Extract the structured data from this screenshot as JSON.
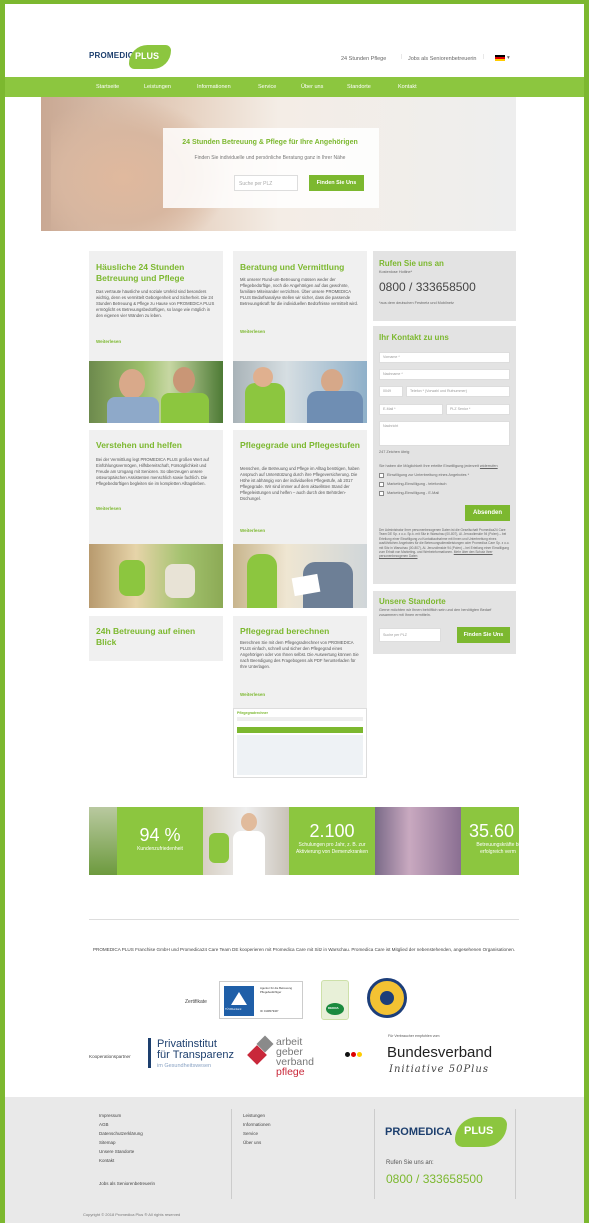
{
  "header": {
    "logo_text": "PROMEDICA",
    "logo_plus": "PLUS",
    "link1": "24 Stunden Pflege",
    "link2": "Jobs als Seniorenbetreuerin",
    "lang_arrow": "▾"
  },
  "nav": [
    "Startseite",
    "Leistungen",
    "Informationen",
    "Service",
    "Über uns",
    "Standorte",
    "Kontakt"
  ],
  "hero": {
    "title": "24 Stunden Betreuung & Pflege für Ihre Angehörigen",
    "subtitle": "Finden Sie individuelle und persönliche Beratung ganz in Ihrer Nähe",
    "placeholder": "Suche per PLZ",
    "button": "Finden Sie Uns"
  },
  "cards": [
    {
      "title": "Häusliche 24 Stunden Betreuung und Pflege",
      "text": "Das vertraute häusliche und soziale Umfeld sind besonders wichtig, denn es vermittelt Geborgenheit und Sicherheit. Die 24 Stunden Betreuung & Pflege zu Hause von PROMEDICA PLUS ermöglicht es Betreuungsbedürftigen, so lange wie möglich in den eigenen vier Wänden zu leben.",
      "more": "Weiterlesen"
    },
    {
      "title": "Beratung und Vermittlung",
      "text": "Mit unserer Rund-um-Betreuung müssen weder der Pflegebedürftige, noch die Angehörigen auf das gewohnte, familiäre Miteinander verzichten. Über unsere PROMEDICA PLUS Bedarfsanalyse stellen wir sicher, dass die passende Betreuungskraft für die individuellen Bedürfnisse vermittelt wird.",
      "more": "Weiterlesen"
    },
    {
      "title": "Verstehen und helfen",
      "text": "Bei der Vermittlung legt PROMEDICA PLUS großen Wert auf Einfühlungsvermögen, Hilfsbereitschaft, Fürsorglichkeit und Freude am Umgang mit Senioren. So überzeugen unsere osteuropäischen Assistenten menschlich sowie fachlich. Die Pflegebedürftigen begleiten sie im kompletten Alltagsleben.",
      "more": "Weiterlesen"
    },
    {
      "title": "Pflegegrade und Pflegestufen",
      "text": "Menschen, die Betreuung und Pflege im Alltag benötigen, haben Anspruch auf Unterstützung durch ihre Pflegeversicherung. Die Höhe ist abhängig von der individuellen Pflegestufe, ab 2017 Pflegegrade. Wir sind immer auf dem aktuellsten Stand der Pflegeleistungen und helfen – auch durch den Behörden-Dschungel.",
      "more": "Weiterlesen"
    },
    {
      "title": "24h Betreuung auf einen Blick",
      "text": "",
      "more": ""
    },
    {
      "title": "Pflegegrad berechnen",
      "text": "Berechnen Sie mit dem Pflegegradrechner von PROMEDICA PLUS einfach, schnell und sicher den Pflegegrad eines Angehörigen oder von Ihnen selbst. Die Auswertung können Sie nach Beendigung des Fragebogens als PDF herunterladen für Ihre Unterlagen.",
      "more": "Weiterlesen",
      "shot_caption": "Pflegegradrechner"
    }
  ],
  "callbox": {
    "title": "Rufen Sie uns an",
    "sub": "Kostenlose Hotline*",
    "phone": "0800 / 333658500",
    "note": "*aus dem deutschen Festnetz und Mobilnetz"
  },
  "contact": {
    "title": "Ihr Kontakt zu uns",
    "firstname": "Vorname *",
    "lastname": "Nachname *",
    "prefix": "0049",
    "phone": "Telefon * (Vorwahl und Rufnummer)",
    "email": "E-Mail *",
    "plz": "PLZ Senior *",
    "message": "Nachricht",
    "counter": "247 Zeichen übrig",
    "consent_intro": "Sie haben die Möglichkeit Ihre erteilte Einwilligung jederzeit",
    "consent_link": "widerrufen",
    "check1": "Einwilligung zur Unterbreitung eines Angebotes *",
    "check2": "Marketing-Einwilligung - telefonisch",
    "check3": "Marketing-Einwilligung - E-Mail",
    "submit": "Absenden",
    "privacy": "Der Administrator Ihrer personenbezogenen Daten ist die Gesellschaft Promedica24 Care Team DE Sp. z o.o. Sp.k. mit Sitz in Warschau (00-807), Al. Jerozolimskie 94 (Polen) – bei Erteilung einer Einwilligung zu Kontaktaufnahme mit Ihnen und Unterbreitung eines ausführlichen Angebotes für die Betreuungsdienstleistungen oder Promedica Care Sp. z o.o. mit Sitz in Warschau (00-807), Al. Jerozolimskie 94 (Polen) – bei Erteilung einer Einwilligung zum Erhalt von Marketing- und Werbeinformationen.",
    "privacy_link": "Mehr über den Schutz Ihrer personenbezogenen Daten"
  },
  "locations": {
    "title": "Unsere Standorte",
    "text": "Gerne möchten wir Ihnen behilflich sein und den benötigten Bedarf zusammen mit Ihnen ermitteln.",
    "placeholder": "Suche per PLZ",
    "button": "Finden Sie Uns"
  },
  "stats": [
    {
      "num": "94 %",
      "label": "Kundenzufriedenheit"
    },
    {
      "num": "2.100",
      "label": "Schulungen pro Jahr, z. B. zur Aktivierung von Demenzkranken"
    },
    {
      "num": "35.60",
      "label": "Betreuungskräfte bi erfolgreich verm"
    }
  ],
  "cooperation": "PROMEDICA PLUS Franchise GmbH und Promedica24 Care Team DE kooperieren mit Promedica Care mit Sitz in Warschau. Promedica Care ist Mitglied der nebenstehenden, angesehenen Organisationen.",
  "certs": {
    "label": "Zertifikate",
    "tuv1": "TÜVRheinland",
    "tuv2": "ZERTIFIZIERT",
    "tuv_text": "Agentur für die Betreuung Pflegebedürftiger",
    "tuv_id": "ID: 9108079467",
    "dekra": "DEKRA",
    "seal": "DEUTSCHER SENIORENRAT"
  },
  "partners": {
    "label": "Kooperationspartner",
    "p1a": "Privatinstitut",
    "p1b": "für Transparenz",
    "p1c": "im Gesundheitswesen",
    "p2a": "arbeit",
    "p2b": "geber",
    "p2c": "verband",
    "p2d": "pflege",
    "p3_small": "Für Verbraucher empfohlen vom",
    "p3a": "Bundesverband",
    "p3b": "Initiative 50Plus"
  },
  "footer": {
    "col1": [
      "Impressum",
      "AGB",
      "Datenschutzerklärung",
      "Sitemap",
      "Unsere Standorte",
      "Kontakt"
    ],
    "jobs": "Jobs als Seniorenbetreuerin",
    "col2": [
      "Leistungen",
      "Informationen",
      "Service",
      "Über uns"
    ],
    "call": "Rufen Sie uns an:",
    "phone": "0800 / 333658500",
    "copyright": "Copyright © 2018 Promedica Plus ® All rights reserved"
  },
  "colors": {
    "brand_green": "#7cb82f",
    "nav_green": "#8cc63f",
    "navy": "#1d3f6e"
  }
}
